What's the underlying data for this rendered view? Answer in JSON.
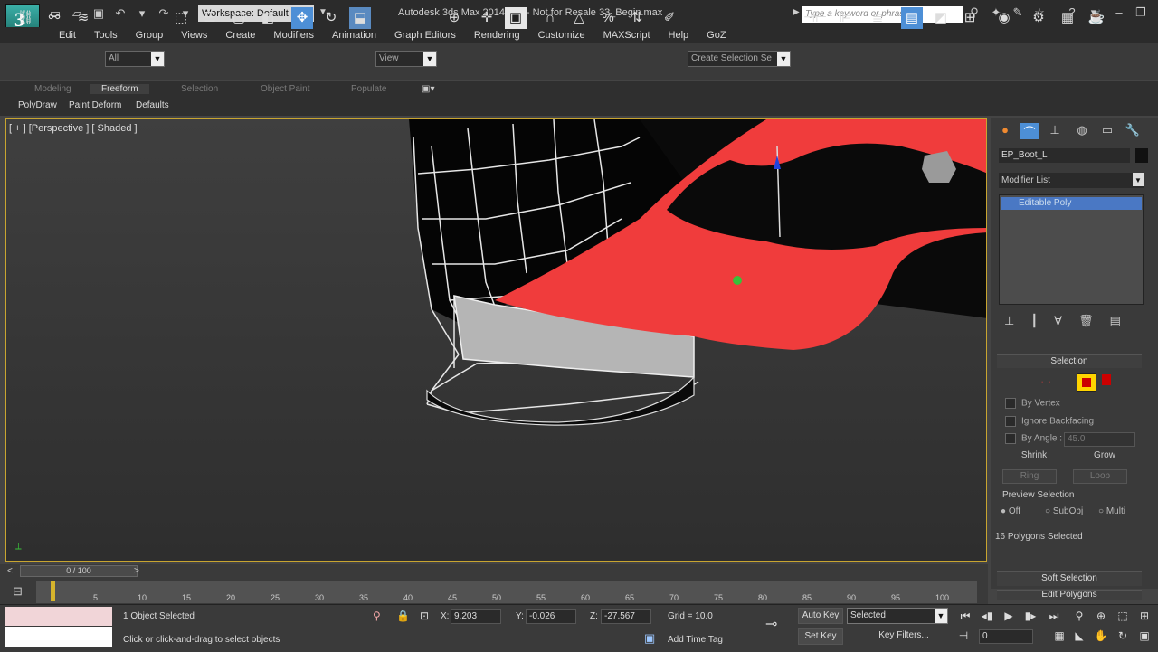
{
  "app": {
    "logo_glyph": "3",
    "title": "Autodesk 3ds Max  2014 x64  - Not for Resale   33_Begin.max",
    "workspace": "Workspace: Default",
    "search_placeholder": "Type a keyword or phrase"
  },
  "menu": [
    "Edit",
    "Tools",
    "Group",
    "Views",
    "Create",
    "Modifiers",
    "Animation",
    "Graph Editors",
    "Rendering",
    "Customize",
    "MAXScript",
    "Help",
    "GoZ"
  ],
  "toolbar": {
    "filter_value": "All",
    "refcoord_value": "View",
    "named_selection_placeholder": "Create Selection Se"
  },
  "ribbon": {
    "tabs": [
      "Modeling",
      "Freeform",
      "Selection",
      "Object Paint",
      "Populate"
    ],
    "active_tab": "Freeform",
    "subtabs": [
      "PolyDraw",
      "Paint Deform",
      "Defaults"
    ]
  },
  "viewport": {
    "label": "[ + ] [Perspective ] [ Shaded ]",
    "highlight_color": "#f03c3c",
    "border_color": "#c8a530"
  },
  "command_panel": {
    "object_name": "EP_Boot_L",
    "modifier_list": "Modifier List",
    "stack_item": "Editable Poly",
    "selection": {
      "title": "Selection",
      "by_vertex": "By Vertex",
      "ignore_backfacing": "Ignore Backfacing",
      "by_angle": "By Angle :",
      "by_angle_value": "45.0",
      "shrink": "Shrink",
      "grow": "Grow",
      "ring": "Ring",
      "loop": "Loop",
      "preview_selection": "Preview Selection",
      "preview_off": "Off",
      "preview_subobj": "SubObj",
      "preview_multi": "Multi",
      "status": "16 Polygons Selected"
    },
    "soft_selection": "Soft Selection",
    "edit_polygons": "Edit Polygons"
  },
  "timeline": {
    "slider_label": "0 / 100",
    "ticks": [
      "5",
      "10",
      "15",
      "20",
      "25",
      "30",
      "35",
      "40",
      "45",
      "50",
      "55",
      "60",
      "65",
      "70",
      "75",
      "80",
      "85",
      "90",
      "95",
      "100"
    ]
  },
  "statusbar": {
    "selection": "1 Object Selected",
    "prompt": "Click or click-and-drag to select objects",
    "x_label": "X:",
    "x_value": "9.203",
    "y_label": "Y:",
    "y_value": "-0.026",
    "z_label": "Z:",
    "z_value": "-27.567",
    "grid": "Grid = 10.0",
    "auto_key": "Auto Key",
    "set_key": "Set Key",
    "key_filters": "Key Filters...",
    "selected_dd": "Selected",
    "add_time_tag": "Add Time Tag",
    "frame_value": "0"
  }
}
